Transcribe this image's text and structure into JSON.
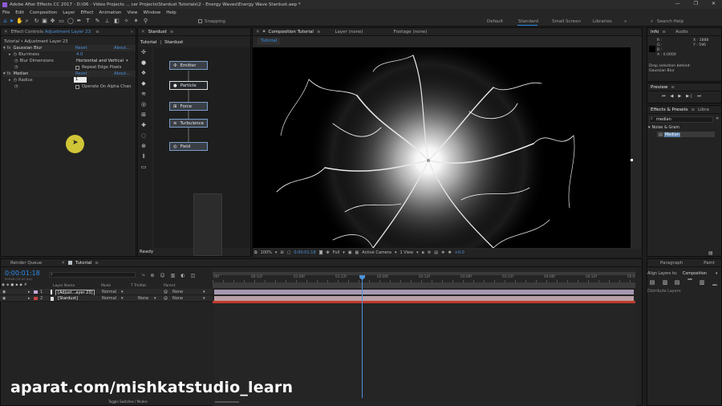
{
  "titlebar": {
    "title": "Adobe After Effects CC 2017 - D:\\06 - Video Projects ... cer Projects\\Stardust Tutorials\\2 - Energy Waves\\Energy Wave Stardust.aep *"
  },
  "menu": [
    "File",
    "Edit",
    "Composition",
    "Layer",
    "Effect",
    "Animation",
    "View",
    "Window",
    "Help"
  ],
  "toolbar": {
    "snapping": "Snapping",
    "workspaces": [
      "Default",
      "Standard",
      "Small Screen",
      "Libraries"
    ],
    "active_workspace": "Standard",
    "search_placeholder": "Search Help"
  },
  "effect_controls": {
    "tab": "Effect Controls Adjustment Layer 23",
    "tab_prefix": "Effect Controls",
    "tab_layer": "Adjustment Layer 23",
    "breadcrumb": "Tutorial • Adjustment Layer 23",
    "effects": [
      {
        "name": "Gaussian Blur",
        "reset": "Reset",
        "about": "About..."
      },
      {
        "name": "Median",
        "reset": "Reset",
        "about": "About..."
      }
    ],
    "blurriness_label": "Blurriness",
    "blurriness_value": "4.0",
    "blur_dimensions_label": "Blur Dimensions",
    "blur_dimensions_value": "Horizontal and Vertical",
    "repeat_edge": "Repeat Edge Pixels",
    "radius_label": "Radius",
    "radius_value": "1",
    "operate_alpha": "Operate On Alpha Chan"
  },
  "stardust": {
    "tab": "Stardust",
    "subtabs": [
      "Tutorial",
      "Stardust"
    ],
    "nodes": [
      {
        "label": "Emitter"
      },
      {
        "label": "Particle"
      },
      {
        "label": "Force"
      },
      {
        "label": "Turbulence"
      },
      {
        "label": "Field"
      }
    ],
    "status": "Ready"
  },
  "composition": {
    "tabs": [
      "Composition Tutorial",
      "Layer (none)",
      "Footage (none)"
    ],
    "subtab": "Tutorial",
    "zoom": "100%",
    "timecode": "0:00:01:18",
    "resolution": "Full",
    "camera": "Active Camera",
    "views": "1 View",
    "exposure": "+0.0"
  },
  "info": {
    "tabs": [
      "Info",
      "Audio"
    ],
    "r": "R :",
    "g": "G :",
    "b": "B :",
    "a": "A : 0.0000",
    "x": "X : 1888",
    "y": "Y : 596",
    "message1": "Drop selection behind:",
    "message2": "Gaussian Blur"
  },
  "preview": {
    "tab": "Preview"
  },
  "effects_presets": {
    "tabs": [
      "Effects & Presets",
      "Libra"
    ],
    "search": "median",
    "category": "Noise & Grain",
    "result": "Median"
  },
  "timeline": {
    "tabs": [
      "Render Queue",
      "Tutorial"
    ],
    "timecode": "0:00:01:18",
    "frame_info": "00048 (25.00 fps)",
    "columns": {
      "layer_name": "Layer Name",
      "mode": "Mode",
      "trkmat": "T  TrkMat",
      "parent": "Parent"
    },
    "layers": [
      {
        "num": "1",
        "name": "[Adjust...ayer 23]",
        "mode": "Normal",
        "trkmat": "",
        "parent": "None",
        "color": "#c8a8d8",
        "bar": "#a69ab3"
      },
      {
        "num": "2",
        "name": "[Stardust]",
        "mode": "Normal",
        "trkmat": "None",
        "parent": "None",
        "color": "#c84040",
        "bar": "#b9a0a5"
      }
    ],
    "ruler": [
      "00f",
      "00:12f",
      "01:00f",
      "01:12f",
      "02:00f",
      "02:12f",
      "03:00f",
      "03:12f",
      "04:00f",
      "04:12f",
      "05:0"
    ],
    "toggle": "Toggle Switches / Modes"
  },
  "paragraph": {
    "tabs": [
      "Paragraph",
      "Paint"
    ],
    "align_to_label": "Align Layers to:",
    "align_to": "Composition",
    "distribute": "Distribute Layers:"
  },
  "watermark": "aparat.com/mishkatstudio_learn",
  "colors": {
    "accent": "#2d8ceb",
    "panel": "#232323",
    "bg": "#1d1d1d"
  }
}
